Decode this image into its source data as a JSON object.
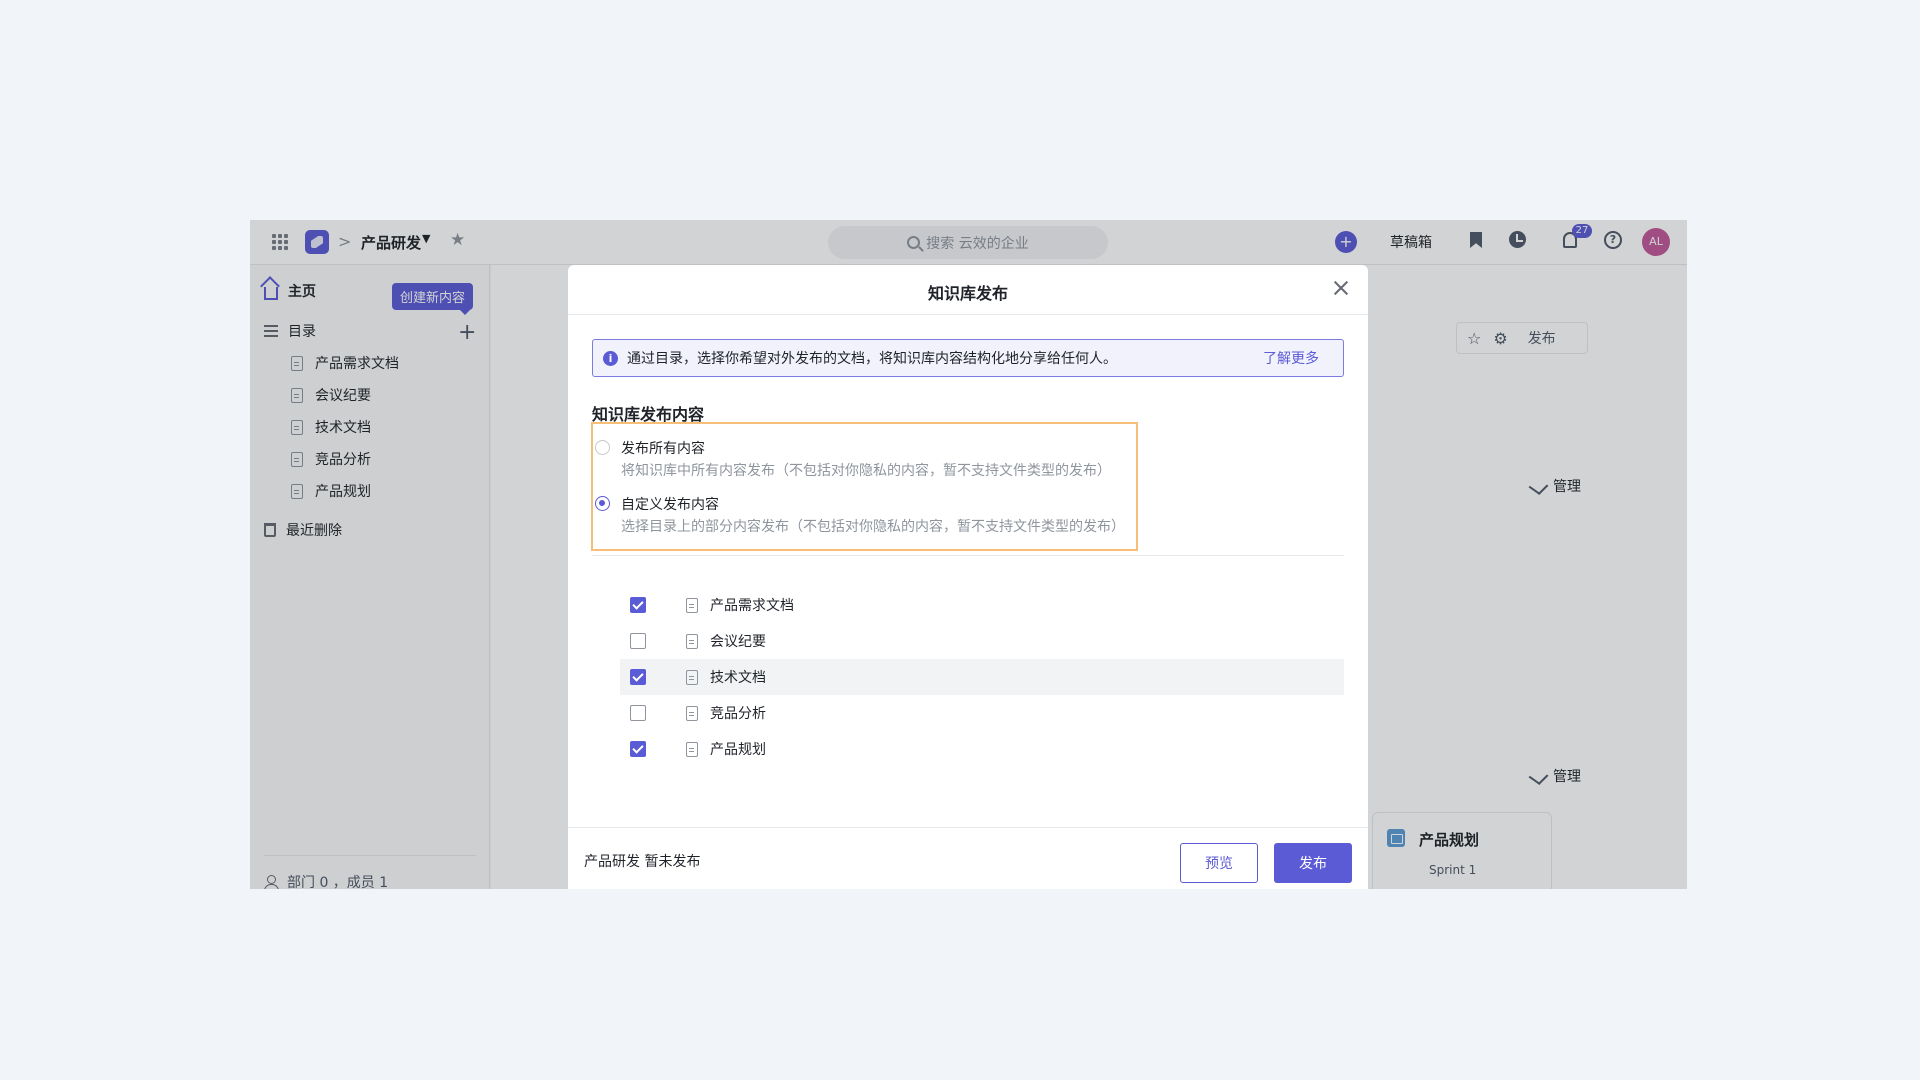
{
  "topbar": {
    "breadcrumb_sep": ">",
    "workspace": "产品研发",
    "search_placeholder": "搜索 云效的企业",
    "drafts": "草稿箱",
    "notification_count": "27",
    "avatar_initials": "AL"
  },
  "sidebar": {
    "home": "主页",
    "tooltip": "创建新内容",
    "catalog": "目录",
    "tree": [
      "产品需求文档",
      "会议纪要",
      "技术文档",
      "竞品分析",
      "产品规划"
    ],
    "trash": "最近删除",
    "members": "部门 0 ，成员 1"
  },
  "background": {
    "toolbar_publish": "发布",
    "manage_1": "管理",
    "manage_2": "管理",
    "card_title": "产品规划",
    "card_subtitle": "Sprint 1"
  },
  "modal": {
    "title": "知识库发布",
    "info_text": "通过目录，选择你希望对外发布的文档，将知识库内容结构化地分享给任何人。",
    "learn_more": "了解更多",
    "section_title": "知识库发布内容",
    "options": [
      {
        "label": "发布所有内容",
        "desc": "将知识库中所有内容发布（不包括对你隐私的内容，暂不支持文件类型的发布）",
        "selected": false
      },
      {
        "label": "自定义发布内容",
        "desc": "选择目录上的部分内容发布（不包括对你隐私的内容，暂不支持文件类型的发布）",
        "selected": true
      }
    ],
    "documents": [
      {
        "name": "产品需求文档",
        "checked": true
      },
      {
        "name": "会议纪要",
        "checked": false
      },
      {
        "name": "技术文档",
        "checked": true
      },
      {
        "name": "竞品分析",
        "checked": false
      },
      {
        "name": "产品规划",
        "checked": true
      }
    ],
    "footer_status": "产品研发 暂未发布",
    "preview_label": "预览",
    "publish_label": "发布"
  },
  "colors": {
    "accent": "#5b5bd6",
    "highlight_border": "#f7be78"
  }
}
